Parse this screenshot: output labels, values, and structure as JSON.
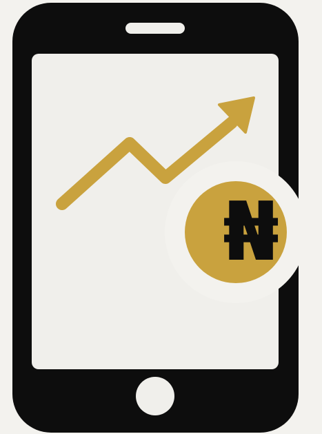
{
  "icon": {
    "name": "smartphone-growth-naira-icon",
    "device": "smartphone-icon",
    "trend": "trend-up-arrow-icon",
    "badge": "naira-coin-icon"
  },
  "badge": {
    "symbol": "₦"
  },
  "colors": {
    "background": "#f3f2ee",
    "device": "#0d0d0d",
    "screen": "#f0efeb",
    "accent": "#c9a23e",
    "symbol": "#0d0d0d"
  }
}
